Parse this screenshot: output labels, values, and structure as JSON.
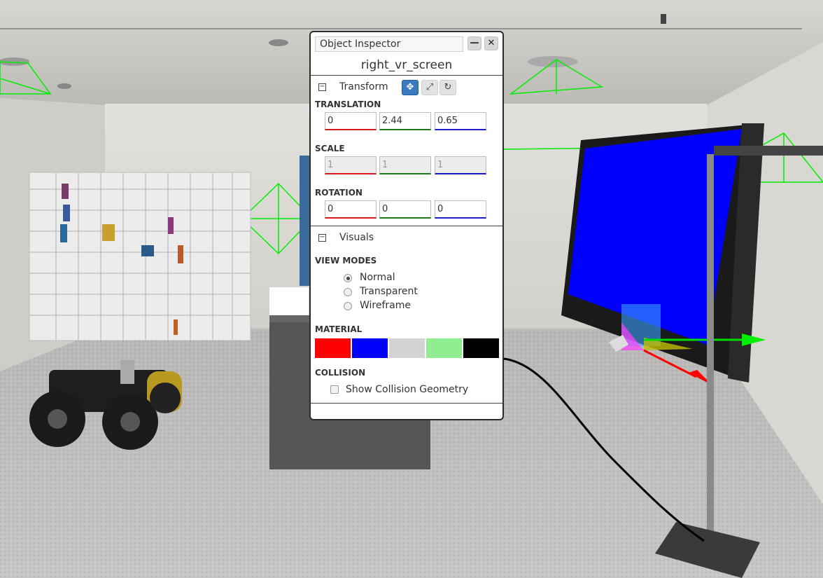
{
  "inspector": {
    "title": "Object Inspector",
    "minimize_icon": "minus-icon",
    "close_icon": "close-icon",
    "object_name": "right_vr_screen"
  },
  "transform": {
    "label": "Transform",
    "collapse_icon": "collapse-minus-icon",
    "tools": [
      "translate-icon",
      "scale-icon",
      "rotate-icon"
    ],
    "active_tool": "translate-icon",
    "translation_label": "TRANSLATION",
    "translation": {
      "x": "0",
      "y": "2.44",
      "z": "0.65"
    },
    "scale_label": "SCALE",
    "scale": {
      "x": "1",
      "y": "1",
      "z": "1"
    },
    "rotation_label": "ROTATION",
    "rotation": {
      "x": "0",
      "y": "0",
      "z": "0"
    }
  },
  "visuals": {
    "label": "Visuals",
    "view_modes_label": "VIEW MODES",
    "view_modes": [
      "Normal",
      "Transparent",
      "Wireframe"
    ],
    "selected_view_mode": "Normal",
    "material_label": "MATERIAL",
    "material_colors": [
      "#ff0000",
      "#0000ff",
      "#d3d3d3",
      "#90ee90",
      "#000000"
    ],
    "collision_label": "COLLISION",
    "collision_checkbox_label": "Show Collision Geometry",
    "collision_checked": false
  },
  "colors": {
    "axis_x": "#d81818",
    "axis_y": "#1a7a1a",
    "axis_z": "#1a1acc",
    "active_tool": "#3a7bbf",
    "screen_blue": "#0000ff",
    "wireframe_green": "#00ee00"
  }
}
